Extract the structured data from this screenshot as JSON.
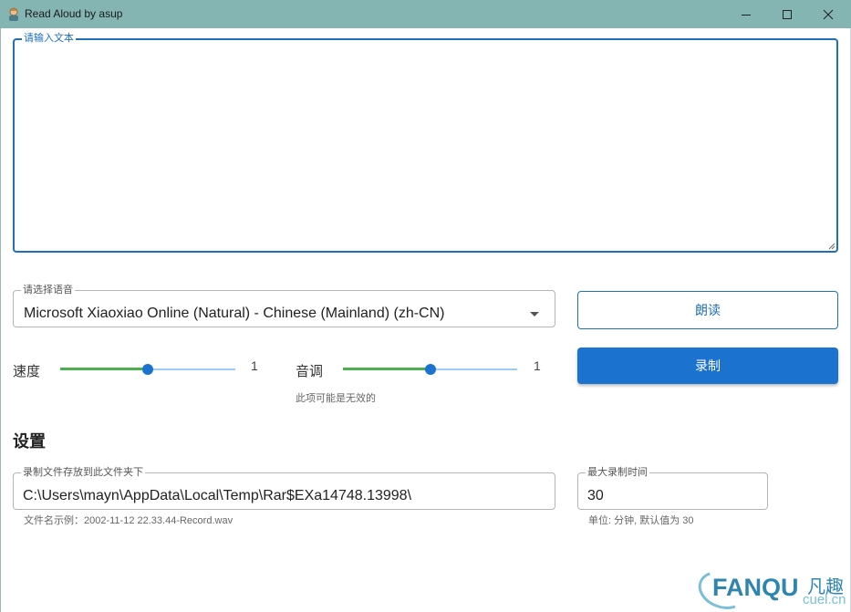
{
  "window": {
    "title": "Read Aloud by asup",
    "icon": "person-app-icon",
    "controls": [
      "minimize-icon",
      "maximize-icon",
      "close-icon"
    ]
  },
  "text_input": {
    "legend": "请输入文本",
    "value": ""
  },
  "voice_select": {
    "legend": "请选择语音",
    "value": "Microsoft Xiaoxiao Online (Natural) - Chinese (Mainland) (zh-CN)"
  },
  "buttons": {
    "read_label": "朗读",
    "record_label": "录制"
  },
  "speed": {
    "label": "速度",
    "value": "1",
    "level": 0.5
  },
  "pitch": {
    "label": "音调",
    "value": "1",
    "level": 0.5,
    "hint": "此项可能是无效的"
  },
  "settings": {
    "title": "设置",
    "folder_legend": "录制文件存放到此文件夹下",
    "folder_value": "C:\\Users\\mayn\\AppData\\Local\\Temp\\Rar$EXa14748.13998\\",
    "folder_hint": "文件名示例：2002-11-12 22.33.44-Record.wav",
    "maxtime_legend": "最大录制时间",
    "maxtime_value": "30",
    "maxtime_hint": "单位: 分钟, 默认值为 30"
  },
  "watermark": {
    "main": "FANQU",
    "cn": "凡趣",
    "url": "cuel.cn"
  },
  "colors": {
    "titlebar": "#84b5b3",
    "accent": "#1c73cf",
    "slider_fill": "#4caf50",
    "slider_track": "#9ccbf3"
  }
}
